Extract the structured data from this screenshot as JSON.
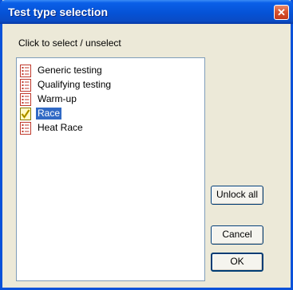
{
  "window": {
    "title": "Test type selection",
    "close_glyph": "✕"
  },
  "instruction": "Click to select / unselect",
  "list": {
    "items": [
      {
        "label": "Generic testing",
        "icon": "list-icon",
        "checked": false,
        "selected": false
      },
      {
        "label": "Qualifying testing",
        "icon": "list-icon",
        "checked": false,
        "selected": false
      },
      {
        "label": "Warm-up",
        "icon": "list-icon",
        "checked": false,
        "selected": false
      },
      {
        "label": "Race",
        "icon": "checkmark-icon",
        "checked": true,
        "selected": true
      },
      {
        "label": "Heat Race",
        "icon": "list-icon",
        "checked": false,
        "selected": false
      }
    ]
  },
  "buttons": {
    "unlock_all": "Unlock all",
    "cancel": "Cancel",
    "ok": "OK"
  },
  "colors": {
    "title_bar": "#0552d6",
    "selection": "#316ac5",
    "list_icon": "#c0392b",
    "checkmark": "#e8c400"
  }
}
